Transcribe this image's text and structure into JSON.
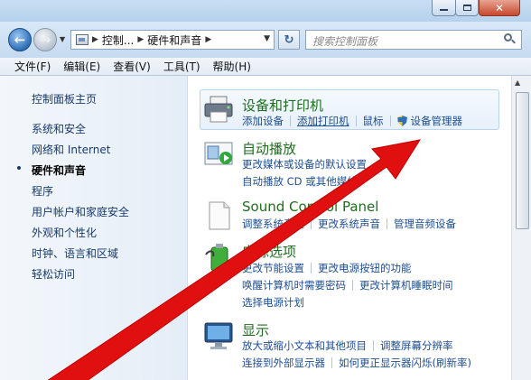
{
  "address": {
    "crumbs": [
      "控制...",
      "硬件和声音"
    ]
  },
  "search": {
    "placeholder": "搜索控制面板"
  },
  "menu": [
    "文件(F)",
    "编辑(E)",
    "查看(V)",
    "工具(T)",
    "帮助(H)"
  ],
  "sidebar": {
    "items": [
      {
        "label": "控制面板主页"
      },
      {
        "label": "系统和安全"
      },
      {
        "label": "网络和 Internet"
      },
      {
        "label": "硬件和声音"
      },
      {
        "label": "程序"
      },
      {
        "label": "用户帐户和家庭安全"
      },
      {
        "label": "外观和个性化"
      },
      {
        "label": "时钟、语言和区域"
      },
      {
        "label": "轻松访问"
      }
    ]
  },
  "categories": [
    {
      "title": "设备和打印机",
      "icon": "printer-icon",
      "links": [
        [
          "添加设备",
          "添加打印机",
          "鼠标",
          "设备管理器"
        ]
      ]
    },
    {
      "title": "自动播放",
      "icon": "autoplay-icon",
      "links": [
        [
          "更改媒体或设备的默认设置"
        ],
        [
          "自动播放 CD 或其他媒体"
        ]
      ]
    },
    {
      "title": "Sound Control Panel",
      "icon": "document-icon",
      "links": [
        [
          "调整系统音量",
          "更改系统声音",
          "管理音频设备"
        ]
      ]
    },
    {
      "title": "电源选项",
      "icon": "battery-icon",
      "links": [
        [
          "更改节能设置",
          "更改电源按钮的功能"
        ],
        [
          "唤醒计算机时需要密码",
          "更改计算机睡眠时间"
        ],
        [
          "选择电源计划"
        ]
      ]
    },
    {
      "title": "显示",
      "icon": "monitor-icon",
      "links": [
        [
          "放大或缩小文本和其他项目",
          "调整屏幕分辨率"
        ],
        [
          "连接到外部显示器",
          "如何更正显示器闪烁(刷新率)"
        ]
      ]
    }
  ],
  "colors": {
    "link": "#1f4e90",
    "category_title": "#1f6e1f",
    "annotation_arrow": "#e01010"
  }
}
